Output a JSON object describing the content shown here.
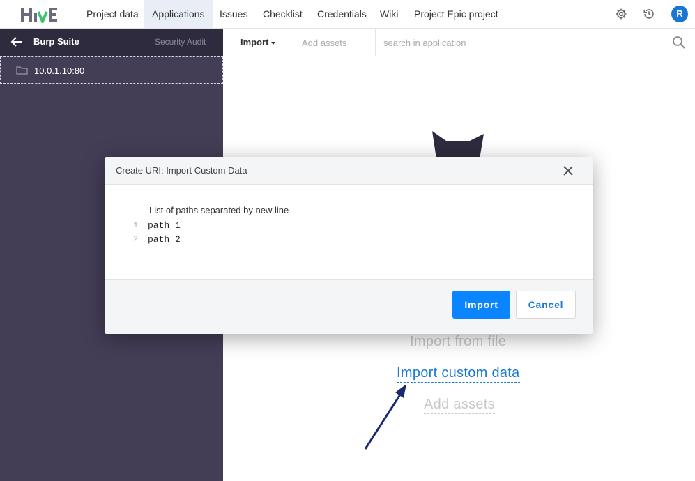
{
  "app": {
    "logo_text": "HIVE",
    "avatar_initial": "R"
  },
  "nav": {
    "items": [
      {
        "label": "Project data"
      },
      {
        "label": "Applications"
      },
      {
        "label": "Issues"
      },
      {
        "label": "Checklist"
      },
      {
        "label": "Credentials"
      },
      {
        "label": "Wiki"
      },
      {
        "label": "Project Epic project"
      }
    ],
    "active": "Applications",
    "icons": [
      "gear-icon",
      "history-icon"
    ]
  },
  "sidebar": {
    "title": "Burp Suite",
    "subtitle": "Security Audit",
    "items": [
      {
        "label": "10.0.1.10:80",
        "icon": "folder-icon"
      }
    ]
  },
  "toolbar": {
    "import_label": "Import",
    "add_assets_label": "Add assets",
    "search_placeholder": "search in application"
  },
  "background_actions": {
    "import_from_file": "Import from file",
    "import_custom_data": "Import custom data",
    "add_assets": "Add assets"
  },
  "modal": {
    "title": "Create URI: Import Custom Data",
    "field_label": "List of paths separated by new line",
    "lines": [
      {
        "number": "1",
        "text": "path_1"
      },
      {
        "number": "2",
        "text": "path_2"
      }
    ],
    "primary_button": "Import",
    "secondary_button": "Cancel"
  },
  "colors": {
    "accent": "#0a84ff",
    "link": "#1a7ad6",
    "sidebar_bg": "#433d56",
    "sidebar_header_bg": "#2f2b3f",
    "arrow": "#1a2a6e"
  }
}
